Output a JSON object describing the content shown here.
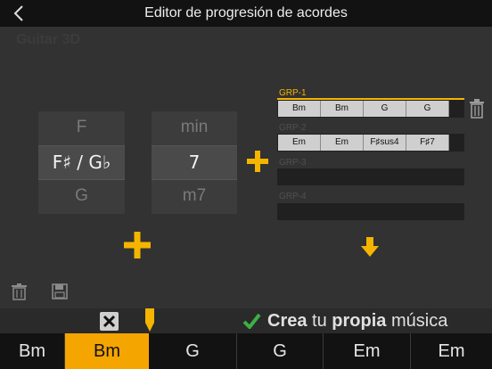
{
  "header": {
    "title": "Editor de progresión de acordes"
  },
  "watermark": "Guitar 3D",
  "root_wheel": {
    "above": "F",
    "selected": "F♯ / G♭",
    "below": "G"
  },
  "type_wheel": {
    "above": "min",
    "selected": "7",
    "below": "m7"
  },
  "groups": [
    {
      "label": "GRP-1",
      "active": true,
      "chords": [
        "Bm",
        "Bm",
        "G",
        "G"
      ]
    },
    {
      "label": "GRP-2",
      "active": false,
      "chords": [
        "Em",
        "Em",
        "F♯sus4",
        "F♯7"
      ]
    },
    {
      "label": "GRP-3",
      "active": false,
      "chords": []
    },
    {
      "label": "GRP-4",
      "active": false,
      "chords": []
    }
  ],
  "progression": [
    "Bm",
    "Bm",
    "G",
    "G",
    "Em",
    "Em"
  ],
  "selected_index": 1,
  "promo": {
    "word1": "Crea",
    "word2": " tu ",
    "word3": "propia",
    "word4": " música"
  },
  "colors": {
    "accent": "#f5b400",
    "check": "#3cb043"
  }
}
